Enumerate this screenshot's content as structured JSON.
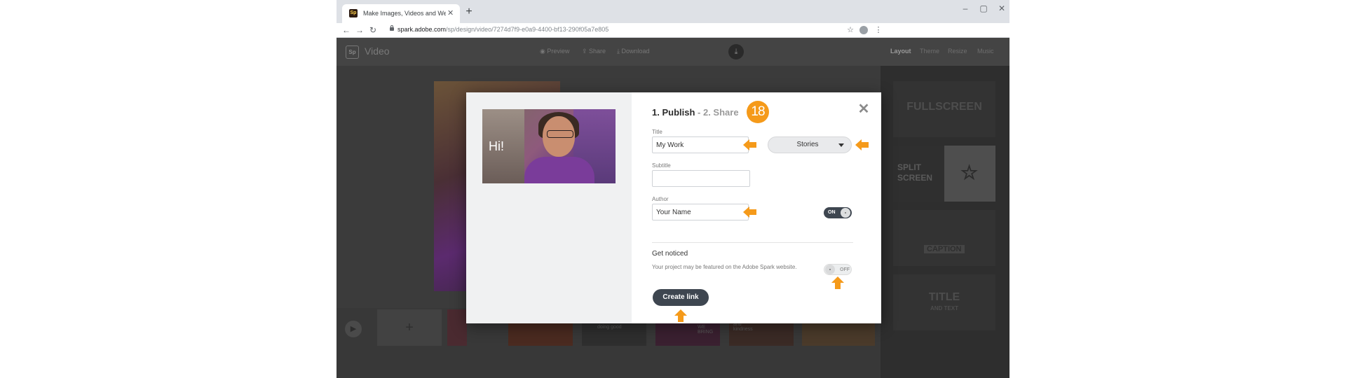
{
  "browser": {
    "tab_title": "Make Images, Videos and Web S",
    "url_domain": "spark.adobe.com",
    "url_path": "/sp/design/video/7274d7f9-e0a9-4400-bf13-290f05a7e805"
  },
  "app": {
    "logo_text": "Sp",
    "name": "Video",
    "header_buttons": [
      "Preview",
      "Share",
      "Download"
    ],
    "right_tabs": [
      "Layout",
      "Theme",
      "Resize",
      "Music"
    ],
    "active_tab": "Layout",
    "layout_cards": [
      {
        "line1": "FULLSCREEN",
        "line2": ""
      },
      {
        "line1": "SPLIT",
        "line2": "SCREEN"
      },
      {
        "line1": "CAPTION",
        "line2": ""
      },
      {
        "line1": "TITLE",
        "line2": "AND TEXT"
      }
    ],
    "timeline_clips": [
      "doing good",
      "WE BRING",
      "and kindness"
    ]
  },
  "modal": {
    "thumbnail_text": "Hi!",
    "step1": "1. Publish",
    "separator": " - ",
    "step2": "2. Share",
    "badge": "18",
    "title_label": "Title",
    "title_value": "My Work",
    "category_value": "Stories",
    "subtitle_label": "Subtitle",
    "subtitle_value": "",
    "author_label": "Author",
    "author_value": "Your Name",
    "author_toggle": "ON",
    "get_noticed_title": "Get noticed",
    "get_noticed_desc": "Your project may be featured on the Adobe Spark website.",
    "featured_toggle": "OFF",
    "create_link_label": "Create link"
  },
  "colors": {
    "accent_orange": "#f59a1a",
    "button_dark": "#3e4650"
  }
}
